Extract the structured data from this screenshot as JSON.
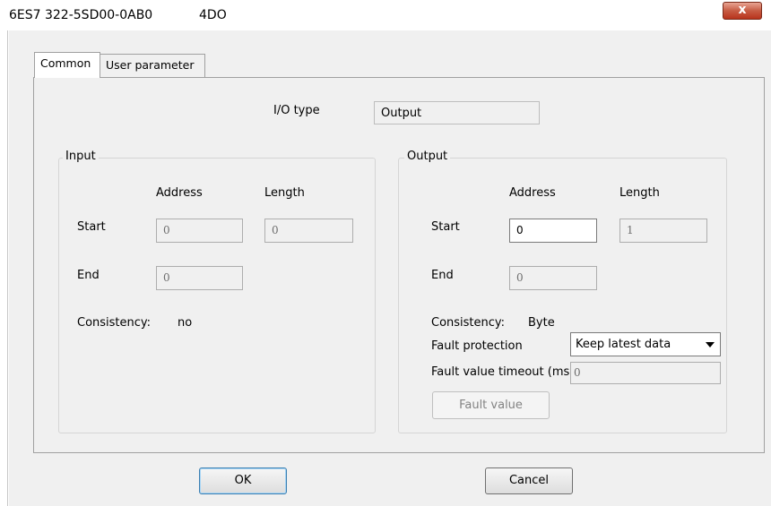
{
  "window": {
    "title_code": "6ES7 322-5SD00-0AB0",
    "title_model": "4DO",
    "close_glyph": "x"
  },
  "tabs": [
    {
      "label": "Common",
      "active": true
    },
    {
      "label": "User parameter",
      "active": false
    }
  ],
  "io_type": {
    "label": "I/O type",
    "value": "Output"
  },
  "input": {
    "legend": "Input",
    "address_header": "Address",
    "length_header": "Length",
    "start_label": "Start",
    "end_label": "End",
    "start_address": "0",
    "start_length": "0",
    "end_address": "0",
    "consistency_label": "Consistency:",
    "consistency_value": "no"
  },
  "output": {
    "legend": "Output",
    "address_header": "Address",
    "length_header": "Length",
    "start_label": "Start",
    "end_label": "End",
    "start_address": "0",
    "start_length": "1",
    "end_address": "0",
    "consistency_label": "Consistency:",
    "consistency_value": "Byte",
    "fault_protection_label": "Fault protection",
    "fault_protection_value": "Keep latest data",
    "fault_timeout_label": "Fault value timeout (ms)",
    "fault_timeout_value": "0",
    "fault_value_button": "Fault value"
  },
  "buttons": {
    "ok": "OK",
    "cancel": "Cancel"
  }
}
